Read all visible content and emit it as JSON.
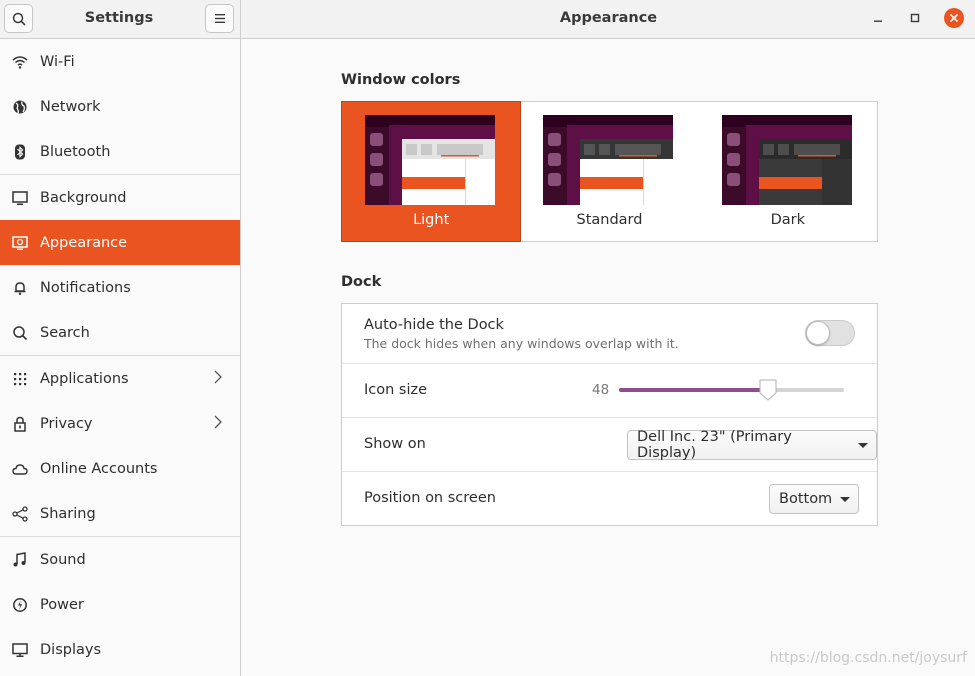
{
  "window": {
    "sidebar_title": "Settings",
    "main_title": "Appearance",
    "accent": "#e95420",
    "controls": {
      "minimize": "minimize-icon",
      "maximize": "maximize-icon",
      "close": "close-icon"
    }
  },
  "sidebar": {
    "items": [
      {
        "label": "Wi-Fi",
        "icon": "wifi-icon"
      },
      {
        "label": "Network",
        "icon": "globe-icon"
      },
      {
        "label": "Bluetooth",
        "icon": "bluetooth-icon"
      },
      {
        "label": "Background",
        "icon": "monitor-icon"
      },
      {
        "label": "Appearance",
        "icon": "appearance-icon",
        "active": true
      },
      {
        "label": "Notifications",
        "icon": "bell-icon"
      },
      {
        "label": "Search",
        "icon": "search-icon"
      },
      {
        "label": "Applications",
        "icon": "apps-grid-icon",
        "has_submenu": true
      },
      {
        "label": "Privacy",
        "icon": "lock-icon",
        "has_submenu": true
      },
      {
        "label": "Online Accounts",
        "icon": "cloud-icon"
      },
      {
        "label": "Sharing",
        "icon": "share-icon"
      },
      {
        "label": "Sound",
        "icon": "music-note-icon"
      },
      {
        "label": "Power",
        "icon": "power-icon"
      },
      {
        "label": "Displays",
        "icon": "display-icon"
      }
    ]
  },
  "appearance": {
    "window_colors": {
      "title": "Window colors",
      "options": [
        {
          "label": "Light",
          "selected": true
        },
        {
          "label": "Standard",
          "selected": false
        },
        {
          "label": "Dark",
          "selected": false
        }
      ]
    },
    "dock": {
      "title": "Dock",
      "autohide": {
        "label": "Auto-hide the Dock",
        "description": "The dock hides when any windows overlap with it.",
        "enabled": false
      },
      "icon_size": {
        "label": "Icon size",
        "value": "48",
        "fraction": 0.66
      },
      "show_on": {
        "label": "Show on",
        "value": "Dell Inc. 23\" (Primary Display)"
      },
      "position": {
        "label": "Position on screen",
        "value": "Bottom"
      }
    }
  },
  "watermark": "https://blog.csdn.net/joysurf"
}
